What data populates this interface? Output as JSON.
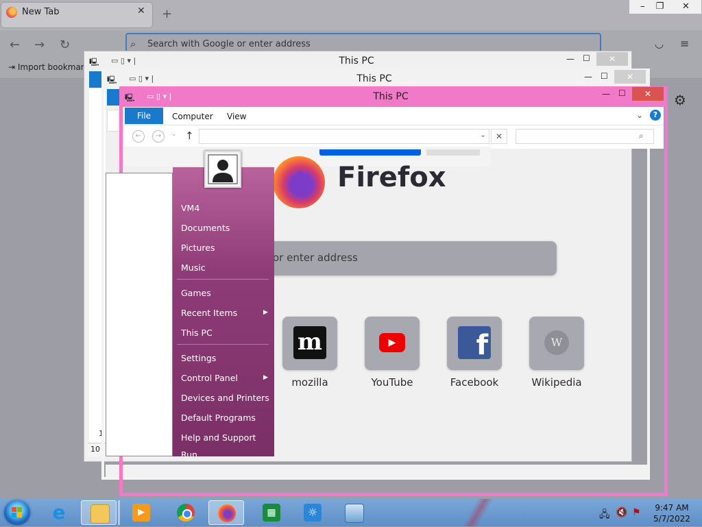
{
  "firefox": {
    "tab_title": "New Tab",
    "tab_close": "✕",
    "new_tab_symbol": "+",
    "window_controls": {
      "minimize": "—",
      "restore": "❐",
      "close": "✕"
    },
    "url_placeholder": "Search with Google or enter address",
    "bookmark_item": "Import bookmarks...",
    "brand": "Firefox",
    "search_placeholder": "Search with Google or enter address",
    "search_visible_fragment": "or enter address",
    "top_sites": [
      {
        "label": "mozilla",
        "icon": "mozilla-m-icon",
        "glyph": "m"
      },
      {
        "label": "YouTube",
        "icon": "youtube-icon",
        "glyph": "▶"
      },
      {
        "label": "Facebook",
        "icon": "facebook-icon",
        "glyph": "f"
      },
      {
        "label": "Wikipedia",
        "icon": "wikipedia-icon",
        "glyph": "W"
      }
    ]
  },
  "explorer_windows": [
    {
      "title": "This PC"
    },
    {
      "title": "This PC"
    },
    {
      "title": "This PC",
      "ribbon_tabs": [
        "File",
        "Computer",
        "View"
      ],
      "help_symbol": "?"
    }
  ],
  "side_fragments": {
    "row_a": "1",
    "row_b": "10"
  },
  "start_menu": {
    "items": [
      {
        "label": "VM4",
        "submenu": false
      },
      {
        "label": "Documents",
        "submenu": false
      },
      {
        "label": "Pictures",
        "submenu": false
      },
      {
        "label": "Music",
        "submenu": false
      },
      {
        "label": "Games",
        "submenu": false
      },
      {
        "label": "Recent Items",
        "submenu": true
      },
      {
        "label": "This PC",
        "submenu": false
      },
      {
        "label": "Settings",
        "submenu": false
      },
      {
        "label": "Control Panel",
        "submenu": true
      },
      {
        "label": "Devices and Printers",
        "submenu": false
      },
      {
        "label": "Default Programs",
        "submenu": false
      },
      {
        "label": "Help and Support",
        "submenu": false
      },
      {
        "label": "Run...",
        "submenu": false
      }
    ]
  },
  "taskbar": {
    "apps": [
      "internet-explorer",
      "file-explorer",
      "media-player",
      "chrome",
      "firefox",
      "store",
      "brightness",
      "display"
    ],
    "clock_time": "9:47 AM",
    "clock_date": "5/7/2022"
  },
  "colors": {
    "explorer_accent": "#f07ac8",
    "ribbon_file_tab": "#1979ca",
    "start_menu_right": "#8f3c78",
    "taskbar": "#6a98cf"
  }
}
